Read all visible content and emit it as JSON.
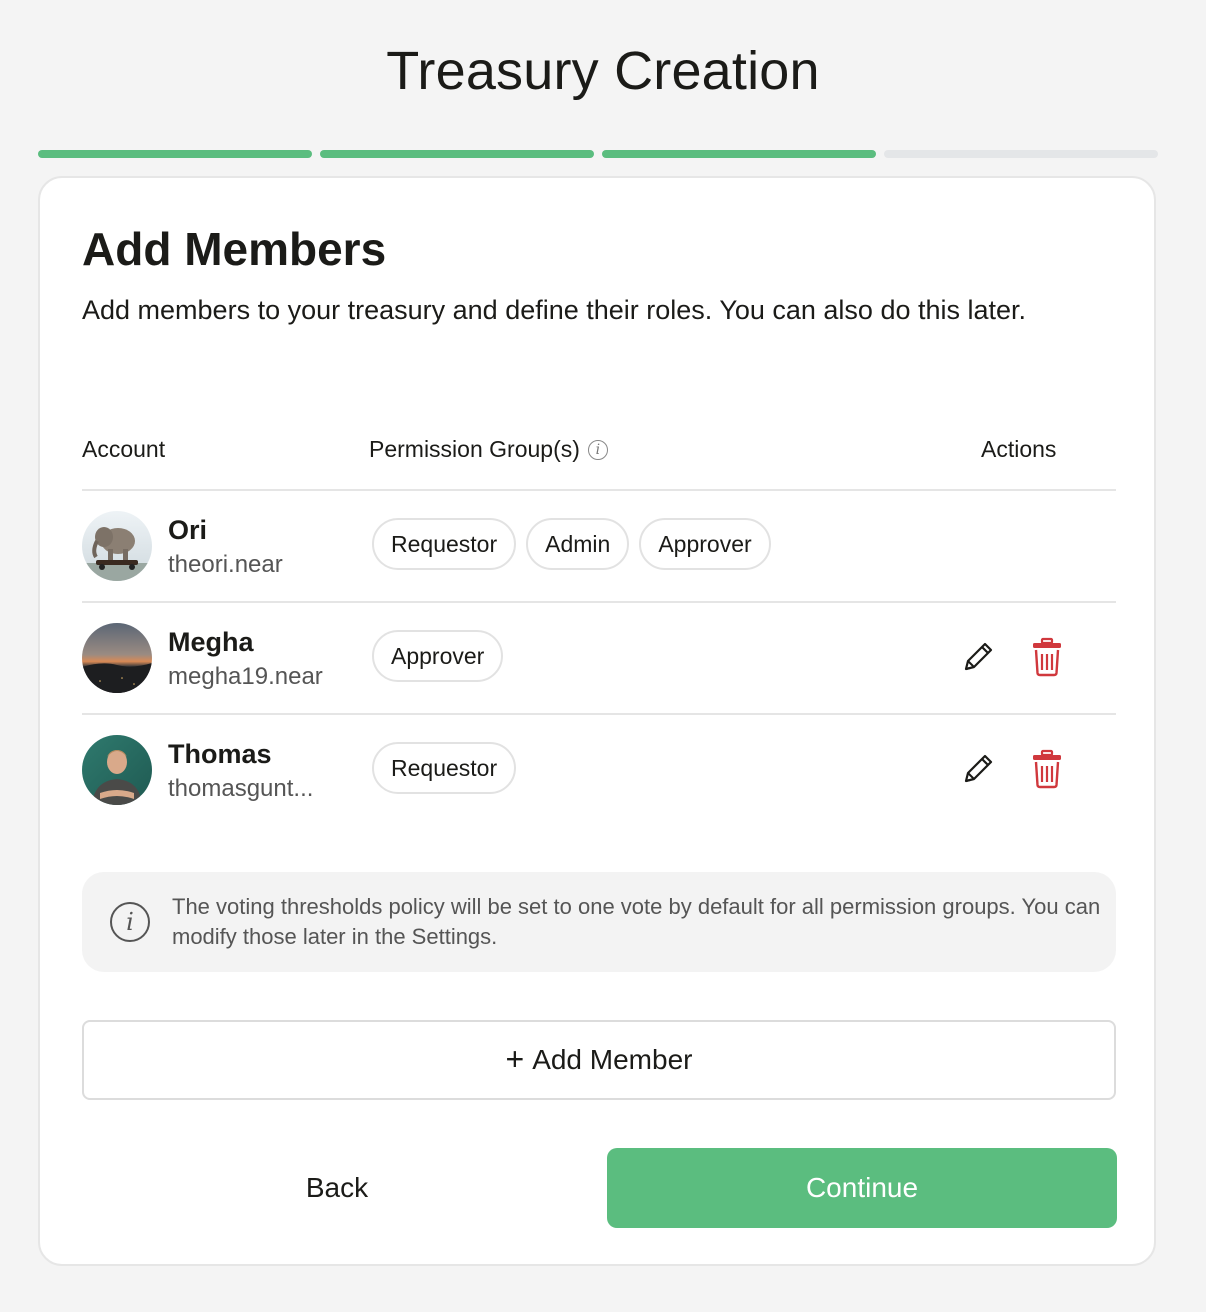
{
  "header": {
    "title": "Treasury Creation",
    "progress_steps_total": 4,
    "progress_steps_completed": 3
  },
  "step": {
    "title": "Add Members",
    "description": "Add members to your treasury and define their roles. You can also do this later."
  },
  "table": {
    "columns": {
      "account": "Account",
      "permission_groups": "Permission Group(s)",
      "actions": "Actions"
    },
    "info_icon": "info-icon",
    "members": [
      {
        "name": "Ori",
        "account": "theori.near",
        "avatar": "elephant-skateboard-avatar",
        "roles": [
          "Requestor",
          "Admin",
          "Approver"
        ],
        "editable": false
      },
      {
        "name": "Megha",
        "account": "megha19.near",
        "avatar": "sunset-landscape-avatar",
        "roles": [
          "Approver"
        ],
        "editable": true
      },
      {
        "name": "Thomas",
        "account": "thomasgunt...",
        "avatar": "person-photo-avatar",
        "roles": [
          "Requestor"
        ],
        "editable": true
      }
    ]
  },
  "notice": {
    "icon": "info-icon",
    "text": "The voting thresholds policy will be set to one vote by default for all permission groups. You can modify those later in the Settings."
  },
  "buttons": {
    "add_member_icon": "plus-icon",
    "add_member_plus": "+",
    "add_member": "Add Member",
    "back": "Back",
    "continue": "Continue"
  },
  "colors": {
    "accent": "#5bbd7f",
    "progress_inactive": "#e4e6e8",
    "delete": "#d0383d",
    "page_background": "#f4f4f4"
  }
}
